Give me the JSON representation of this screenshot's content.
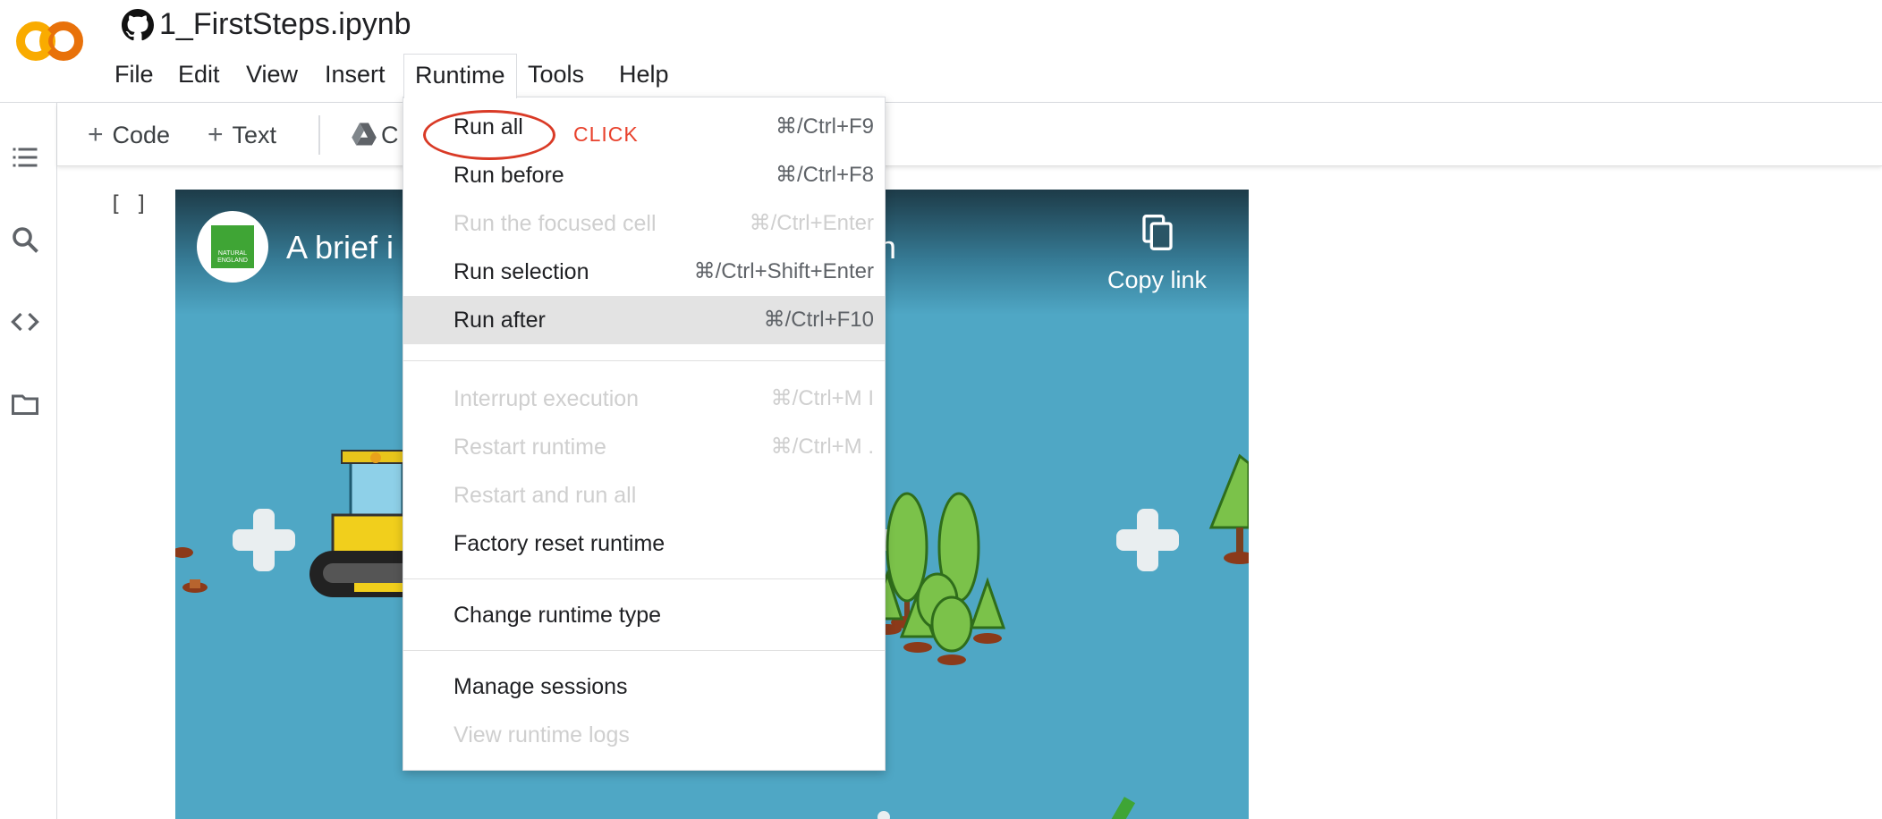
{
  "header": {
    "notebook_title": "1_FirstSteps.ipynb",
    "menu": [
      "File",
      "Edit",
      "View",
      "Insert",
      "Runtime",
      "Tools",
      "Help"
    ],
    "open_menu": "Runtime"
  },
  "toolbar": {
    "add_code": "Code",
    "add_text": "Text",
    "copy_to_drive_partial": "C"
  },
  "cell": {
    "run_brackets": "[ ]",
    "video": {
      "badge_text": "NATURAL ENGLAND",
      "title_start": "A brief i",
      "title_end": "n",
      "copy_link": "Copy link"
    }
  },
  "runtime_menu": {
    "items": [
      {
        "label": "Run all",
        "shortcut": "⌘/Ctrl+F9",
        "enabled": true
      },
      {
        "label": "Run before",
        "shortcut": "⌘/Ctrl+F8",
        "enabled": true
      },
      {
        "label": "Run the focused cell",
        "shortcut": "⌘/Ctrl+Enter",
        "enabled": false
      },
      {
        "label": "Run selection",
        "shortcut": "⌘/Ctrl+Shift+Enter",
        "enabled": true
      },
      {
        "label": "Run after",
        "shortcut": "⌘/Ctrl+F10",
        "enabled": true,
        "highlighted": true
      },
      {
        "label": "Interrupt execution",
        "shortcut": "⌘/Ctrl+M I",
        "enabled": false
      },
      {
        "label": "Restart runtime",
        "shortcut": "⌘/Ctrl+M .",
        "enabled": false
      },
      {
        "label": "Restart and run all",
        "shortcut": "",
        "enabled": false
      },
      {
        "label": "Factory reset runtime",
        "shortcut": "",
        "enabled": true
      },
      {
        "label": "Change runtime type",
        "shortcut": "",
        "enabled": true
      },
      {
        "label": "Manage sessions",
        "shortcut": "",
        "enabled": true
      },
      {
        "label": "View runtime logs",
        "shortcut": "",
        "enabled": false
      }
    ]
  },
  "annotation": {
    "label": "CLICK",
    "target": "Run all",
    "color": "#e8412c"
  },
  "icons": {
    "rail": [
      "table-of-contents-icon",
      "search-icon",
      "code-snippets-icon",
      "files-folder-icon"
    ]
  },
  "colors": {
    "video_background": "#4fa7c5",
    "highlight_row": "#e3e3e3",
    "colab_orange": "#f9ab00",
    "colab_dark_orange": "#e8710a"
  }
}
